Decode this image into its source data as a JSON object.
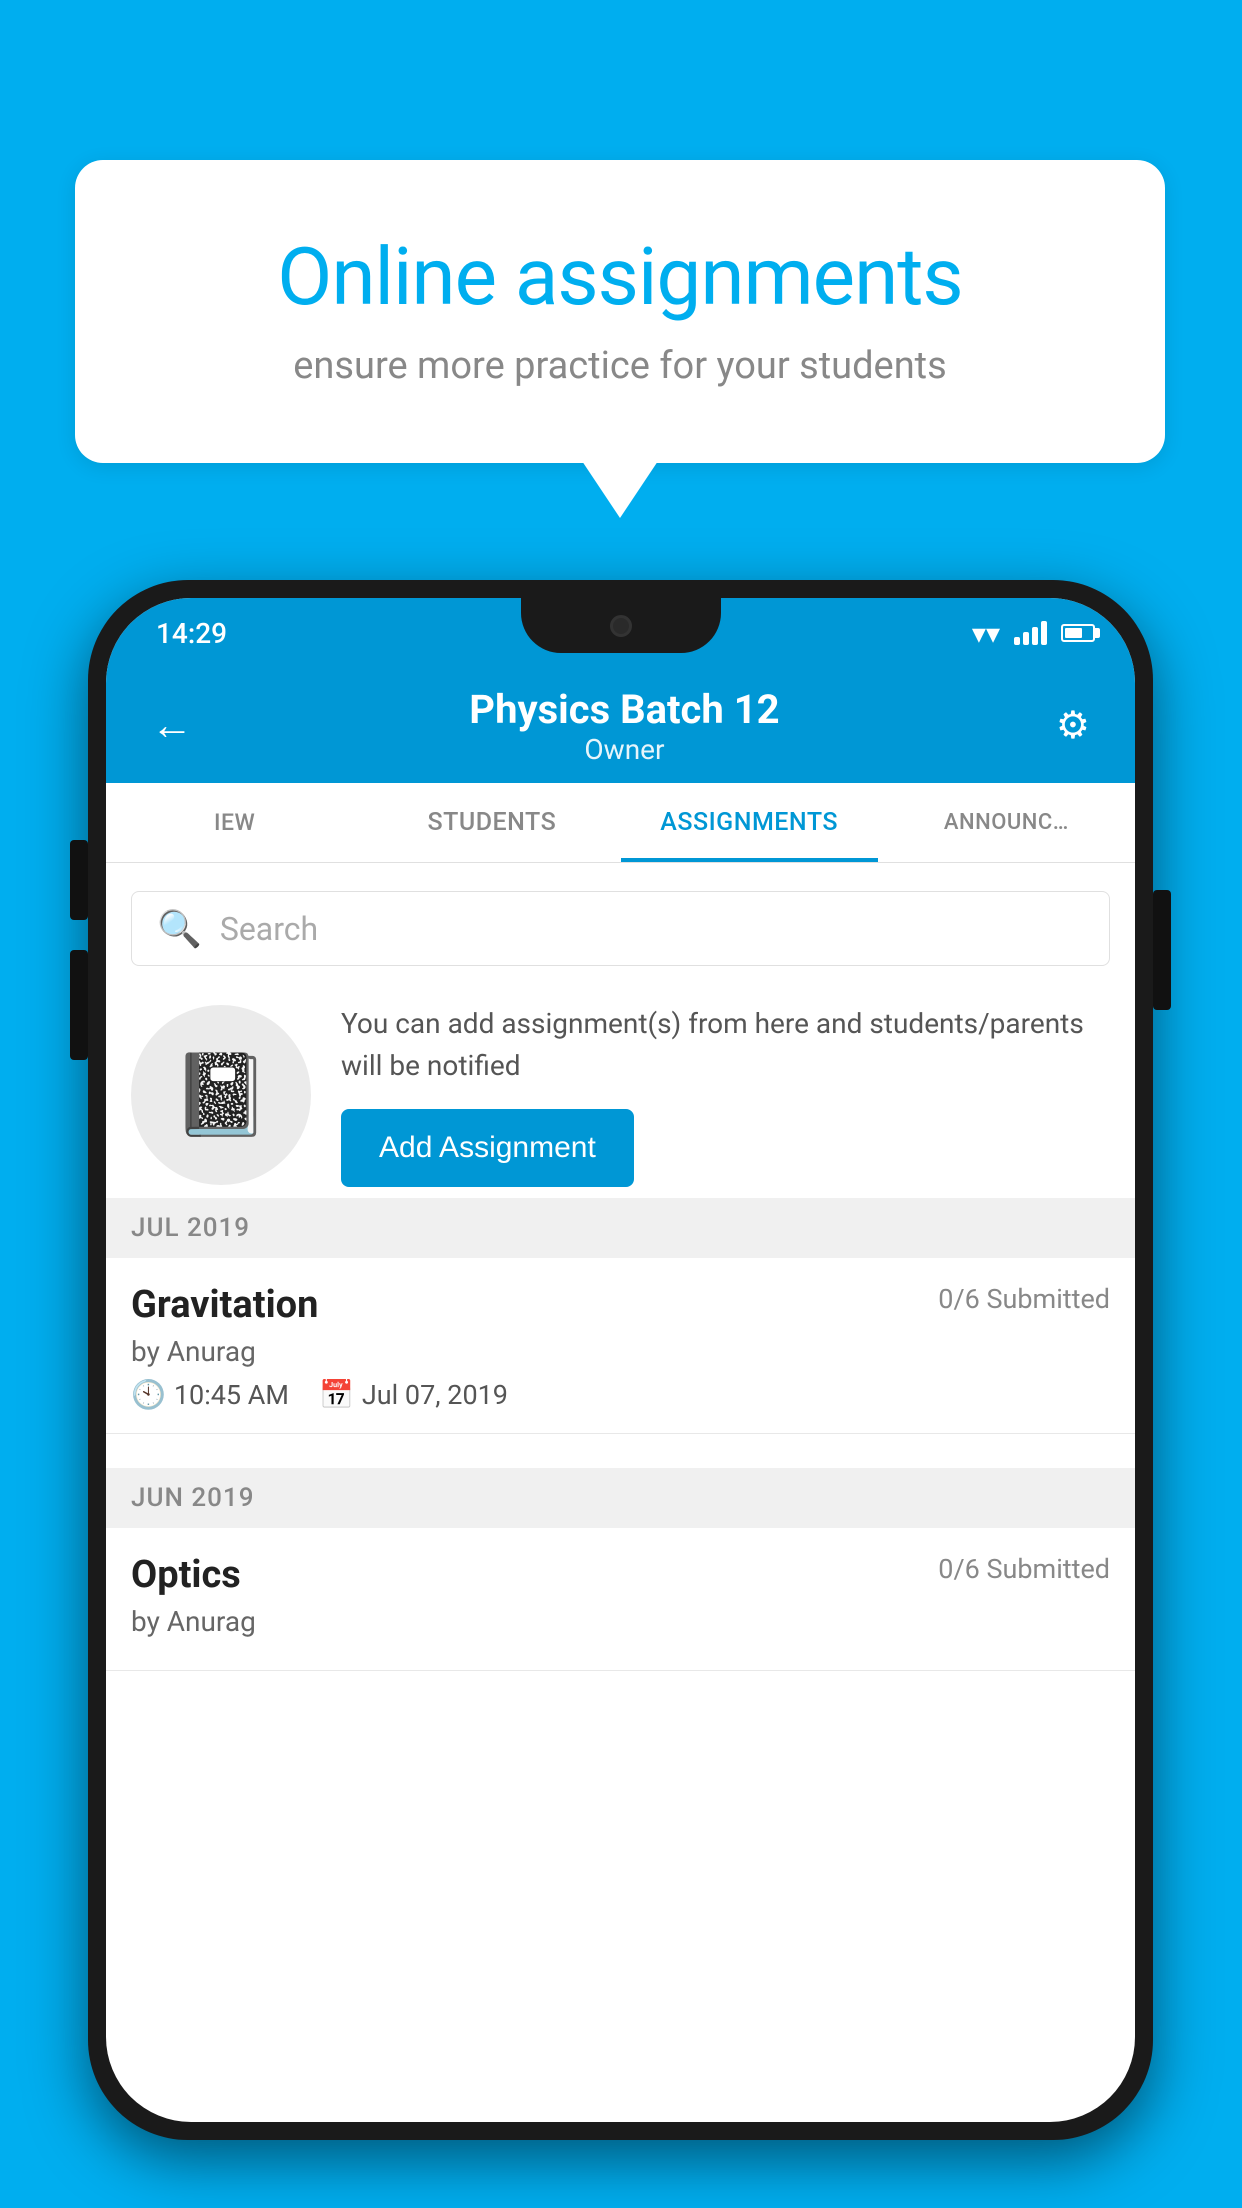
{
  "background_color": "#00AEEF",
  "speech_bubble": {
    "title": "Online assignments",
    "subtitle": "ensure more practice for your students"
  },
  "phone": {
    "status_bar": {
      "time": "14:29"
    },
    "app_bar": {
      "title": "Physics Batch 12",
      "subtitle": "Owner",
      "back_label": "←",
      "settings_label": "⚙"
    },
    "tabs": [
      {
        "label": "IEW",
        "active": false
      },
      {
        "label": "STUDENTS",
        "active": false
      },
      {
        "label": "ASSIGNMENTS",
        "active": true
      },
      {
        "label": "ANNOUNCEMENTS",
        "active": false
      }
    ],
    "search": {
      "placeholder": "Search"
    },
    "add_assignment": {
      "description": "You can add assignment(s) from here and students/parents will be notified",
      "button_label": "Add Assignment"
    },
    "month_sections": [
      {
        "label": "JUL 2019",
        "assignments": [
          {
            "name": "Gravitation",
            "submitted": "0/6 Submitted",
            "by": "by Anurag",
            "time": "10:45 AM",
            "date": "Jul 07, 2019"
          }
        ]
      },
      {
        "label": "JUN 2019",
        "assignments": [
          {
            "name": "Optics",
            "submitted": "0/6 Submitted",
            "by": "by Anurag",
            "time": "",
            "date": ""
          }
        ]
      }
    ]
  }
}
